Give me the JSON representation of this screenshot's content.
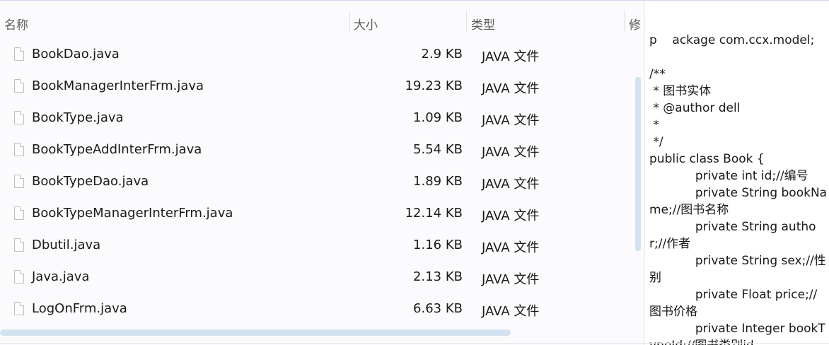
{
  "columns": {
    "name": "名称",
    "size": "大小",
    "type": "类型",
    "date_partial": "修"
  },
  "files": [
    {
      "name": "BookDao.java",
      "size": "2.9 KB",
      "type": "JAVA 文件"
    },
    {
      "name": "BookManagerInterFrm.java",
      "size": "19.23 KB",
      "type": "JAVA 文件"
    },
    {
      "name": "BookType.java",
      "size": "1.09 KB",
      "type": "JAVA 文件"
    },
    {
      "name": "BookTypeAddInterFrm.java",
      "size": "5.54 KB",
      "type": "JAVA 文件"
    },
    {
      "name": "BookTypeDao.java",
      "size": "1.89 KB",
      "type": "JAVA 文件"
    },
    {
      "name": "BookTypeManagerInterFrm.java",
      "size": "12.14 KB",
      "type": "JAVA 文件"
    },
    {
      "name": "Dbutil.java",
      "size": "1.16 KB",
      "type": "JAVA 文件"
    },
    {
      "name": "Java.java",
      "size": "2.13 KB",
      "type": "JAVA 文件"
    },
    {
      "name": "LogOnFrm.java",
      "size": "6.63 KB",
      "type": "JAVA 文件"
    }
  ],
  "preview": {
    "code": "p    ackage com.ccx.model;\n\n/**\n * 图书实体\n * @author dell\n *\n */\npublic class Book {\n            private int id;//编号\n            private String bookName;//图书名称\n            private String author;//作者\n            private String sex;//性别\n            private Float price;//图书价格\n            private Integer bookTypeId;//图书类别id"
  },
  "colors": {
    "scrollbar": "#d2e2ef",
    "header_text": "#5b5b5b",
    "text": "#1a1a1a"
  },
  "icons": {
    "file": "file-icon"
  }
}
